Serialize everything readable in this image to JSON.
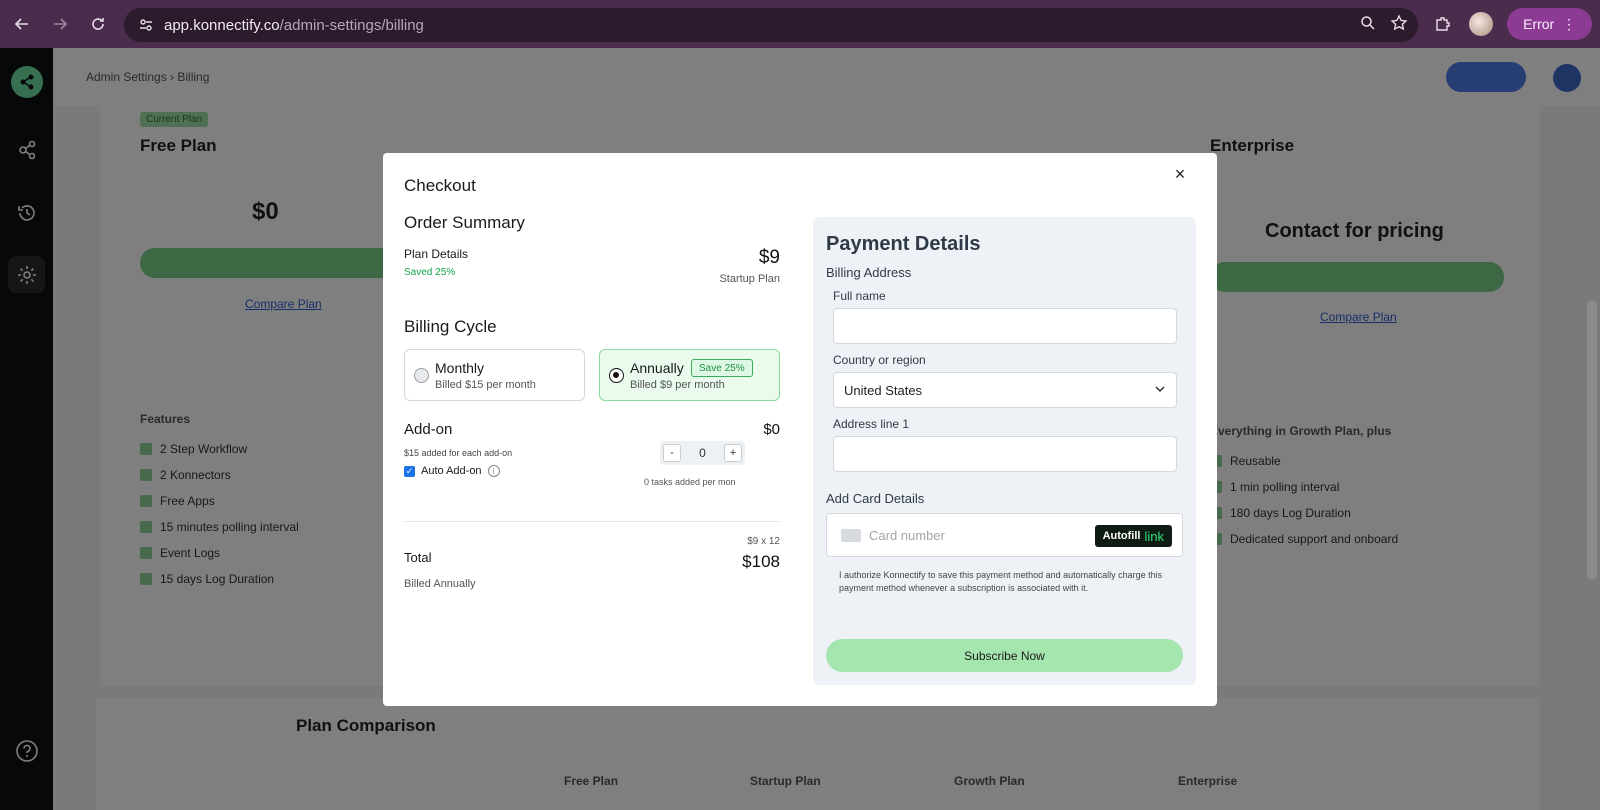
{
  "browser": {
    "url_host": "app.konnectify.co",
    "url_path": "/admin-settings/billing",
    "profile_status": "Error"
  },
  "background": {
    "breadcrumb": "Admin Settings  ›  Billing",
    "plans": [
      {
        "name": "Free Plan",
        "price": "$0",
        "badge": "Current Plan"
      },
      {
        "name": "Startup Plan"
      },
      {
        "name": "Growth Plan"
      },
      {
        "name": "Enterprise",
        "price": "Contact for pricing"
      }
    ],
    "compare_link": "Compare Plan",
    "free_features_title": "Features",
    "free_features": [
      "2 Step Workflow",
      "2 Konnectors",
      "Free Apps",
      "15 minutes polling interval",
      "Event Logs",
      "15 days Log Duration"
    ],
    "enterprise_features_title": "Everything in Growth Plan, plus",
    "enterprise_features": [
      "Reusable",
      "1 min polling interval",
      "180 days Log Duration",
      "Dedicated support and onboard"
    ],
    "comparison_title": "Plan Comparison",
    "comparison_headers": [
      "Free Plan",
      "Startup Plan",
      "Growth Plan",
      "Enterprise"
    ]
  },
  "modal": {
    "title": "Checkout",
    "close_icon": "×",
    "order_summary": {
      "heading": "Order Summary",
      "plan_details_label": "Plan Details",
      "saved_text": "Saved 25%",
      "price": "$9",
      "plan_name": "Startup Plan"
    },
    "billing_cycle": {
      "heading": "Billing Cycle",
      "options": [
        {
          "name": "Monthly",
          "sub": "Billed $15 per month",
          "selected": false
        },
        {
          "name": "Annually",
          "sub": "Billed $9 per month",
          "badge": "Save 25%",
          "selected": true
        }
      ]
    },
    "addon": {
      "heading": "Add-on",
      "price": "$0",
      "description": "$15 added for each add-on",
      "auto_label": "Auto Add-on",
      "auto_checked": true,
      "minus": "-",
      "plus": "+",
      "quantity": "0",
      "tasks_note": "0 tasks added per mon"
    },
    "total": {
      "label": "Total",
      "sub": "Billed Annually",
      "calc": "$9 x 12",
      "amount": "$108"
    },
    "payment": {
      "heading": "Payment Details",
      "billing_address": "Billing Address",
      "full_name_label": "Full name",
      "full_name_value": "",
      "country_label": "Country or region",
      "country_value": "United States",
      "address_label": "Address line 1",
      "address_value": "",
      "card_heading": "Add Card Details",
      "card_placeholder": "Card number",
      "autofill_label": "Autofill",
      "autofill_link": "link",
      "authorize_text": "I authorize Konnectify to save this payment method and automatically charge this payment method whenever a subscription is associated with it.",
      "subscribe_label": "Subscribe Now"
    }
  },
  "colors": {
    "accent_green": "#a5e6ae",
    "brand_purple": "#8c3a93",
    "sidebar_bg": "#0f1112"
  }
}
